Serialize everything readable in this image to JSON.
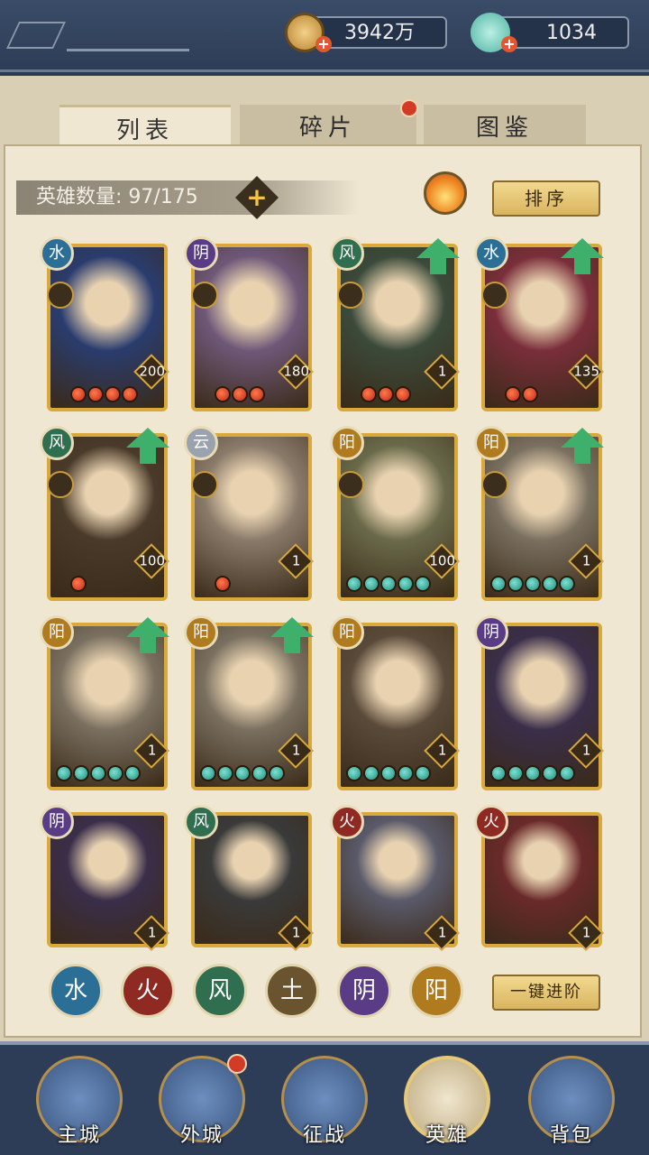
{
  "resources": {
    "coins": "3942万",
    "jade": "1034"
  },
  "tabs": [
    {
      "label": "列表"
    },
    {
      "label": "碎片"
    },
    {
      "label": "图鉴"
    }
  ],
  "hero_count": "英雄数量: 97/175",
  "sort_label": "排序",
  "promote_label": "一键进阶",
  "heroes": [
    {
      "element": "水",
      "level": "200",
      "stars": 4,
      "star_color": "red",
      "upgrade": false
    },
    {
      "element": "阴",
      "level": "180",
      "stars": 3,
      "star_color": "red",
      "upgrade": false
    },
    {
      "element": "风",
      "level": "1",
      "stars": 3,
      "star_color": "red",
      "upgrade": true
    },
    {
      "element": "水",
      "level": "135",
      "stars": 2,
      "star_color": "red",
      "upgrade": true
    },
    {
      "element": "风",
      "level": "100",
      "stars": 1,
      "star_color": "red",
      "upgrade": true
    },
    {
      "element": "云",
      "level": "1",
      "stars": 1,
      "star_color": "red",
      "upgrade": false
    },
    {
      "element": "阳",
      "level": "100",
      "stars": 5,
      "star_color": "green",
      "upgrade": false
    },
    {
      "element": "阳",
      "level": "1",
      "stars": 5,
      "star_color": "green",
      "upgrade": true
    },
    {
      "element": "阳",
      "level": "1",
      "stars": 5,
      "star_color": "green",
      "upgrade": true
    },
    {
      "element": "阳",
      "level": "1",
      "stars": 5,
      "star_color": "green",
      "upgrade": true
    },
    {
      "element": "阳",
      "level": "1",
      "stars": 5,
      "star_color": "green",
      "upgrade": false
    },
    {
      "element": "阴",
      "level": "1",
      "stars": 5,
      "star_color": "green",
      "upgrade": false
    },
    {
      "element": "阴",
      "level": "1",
      "stars": 0,
      "star_color": "green",
      "upgrade": false
    },
    {
      "element": "风",
      "level": "1",
      "stars": 0,
      "star_color": "green",
      "upgrade": false
    },
    {
      "element": "火",
      "level": "1",
      "stars": 0,
      "star_color": "green",
      "upgrade": false
    },
    {
      "element": "火",
      "level": "1",
      "stars": 0,
      "star_color": "green",
      "upgrade": false
    }
  ],
  "filters": [
    {
      "glyph": "水",
      "color": "#2c6f96"
    },
    {
      "glyph": "火",
      "color": "#8f2a22"
    },
    {
      "glyph": "风",
      "color": "#2f6e4f"
    },
    {
      "glyph": "土",
      "color": "#6a5430"
    },
    {
      "glyph": "阴",
      "color": "#5a3c86"
    },
    {
      "glyph": "阳",
      "color": "#b07a1e"
    }
  ],
  "nav": [
    {
      "label": "主城",
      "dot": false
    },
    {
      "label": "外城",
      "dot": true
    },
    {
      "label": "征战",
      "dot": false
    },
    {
      "label": "英雄",
      "dot": false
    },
    {
      "label": "背包",
      "dot": false
    }
  ],
  "colors": {
    "element_water": "#2c6f96",
    "element_fire": "#8f2a22",
    "element_wind": "#2f6e4f",
    "element_yin": "#5a3c86",
    "element_yang": "#b07a1e",
    "element_cloud": "#9aa3ad"
  }
}
